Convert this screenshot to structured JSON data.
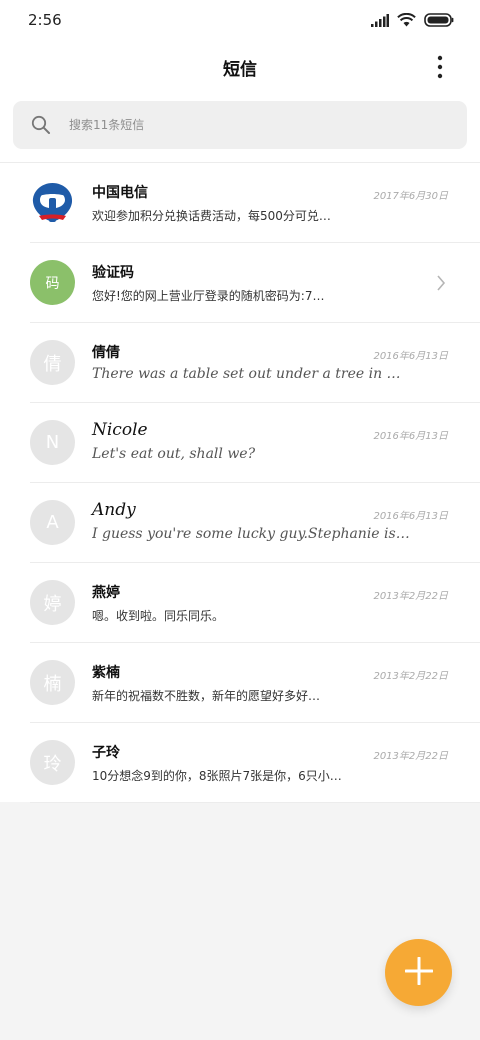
{
  "status_bar": {
    "time": "2:56",
    "icons": [
      "signal-icon",
      "wifi-icon",
      "battery-icon"
    ]
  },
  "header": {
    "title": "短信",
    "more_icon": "more-vertical-icon"
  },
  "search": {
    "placeholder": "搜索11条短信"
  },
  "conversations": [
    {
      "name": "中国电信",
      "preview": "欢迎参加积分兑换话费活动，每500分可兑…",
      "date": "2017年6月30日",
      "avatar": "china-telecom-logo"
    },
    {
      "name": "验证码",
      "preview": "您好!您的网上营业厅登录的随机密码为:7…",
      "date": "",
      "avatar_text": "码",
      "avatar_color": "#8bc06a"
    },
    {
      "name": "倩倩",
      "preview": "There was a table set out under a tree in …",
      "date": "2016年6月13日",
      "avatar_text": "倩"
    },
    {
      "name": "Nicole",
      "preview": "Let's eat out, shall we?",
      "date": "2016年6月13日",
      "avatar_text": "N"
    },
    {
      "name": "Andy",
      "preview": "I guess you're some lucky guy.Stephanie is…",
      "date": "2016年6月13日",
      "avatar_text": "A"
    },
    {
      "name": "燕婷",
      "preview": "嗯。收到啦。同乐同乐。",
      "date": "2013年2月22日",
      "avatar_text": "婷"
    },
    {
      "name": "紫楠",
      "preview": "新年的祝福数不胜数，新年的愿望好多好…",
      "date": "2013年2月22日",
      "avatar_text": "楠"
    },
    {
      "name": "子玲",
      "preview": "10分想念9到的你，8张照片7张是你，6只小…",
      "date": "2013年2月22日",
      "avatar_text": "玲"
    }
  ],
  "fab": {
    "icon": "plus-icon",
    "color": "#f6a935"
  }
}
